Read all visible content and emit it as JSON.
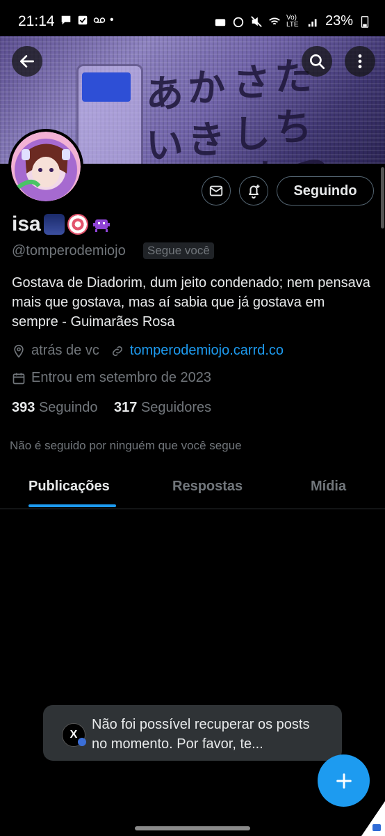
{
  "status_bar": {
    "time": "21:14",
    "battery": "23%",
    "network": "Vo) LTE"
  },
  "header": {
    "back_icon": "arrow-left-icon",
    "search_icon": "search-icon",
    "more_icon": "more-vertical-icon"
  },
  "profile": {
    "name": "isa",
    "handle": "@tomperodemiojo",
    "follows_you": "Segue você",
    "bio": "Gostava de Diadorim, dum jeito condenado; nem pensava mais que gostava, mas aí sabia que já gostava em sempre  - Guimarães Rosa",
    "location": "atrás de vc",
    "website": "tomperodemiojo.carrd.co",
    "joined": "Entrou em setembro de 2023",
    "following_count": "393",
    "following_label": "Seguindo",
    "followers_count": "317",
    "followers_label": "Seguidores",
    "not_followed": "Não é seguido por ninguém que você segue"
  },
  "actions": {
    "follow_label": "Seguindo"
  },
  "tabs": [
    {
      "label": "Publicações",
      "active": true
    },
    {
      "label": "Respostas",
      "active": false
    },
    {
      "label": "Mídia",
      "active": false
    }
  ],
  "toast": {
    "message": "Não foi possível recuperar os posts no momento. Por favor, te..."
  },
  "banner_text": [
    "あ",
    "か",
    "さ",
    "た",
    "い",
    "き",
    "し",
    "ち",
    "す",
    "つ"
  ],
  "colors": {
    "accent": "#1d9bf0",
    "background": "#000000",
    "muted": "#71767b"
  }
}
